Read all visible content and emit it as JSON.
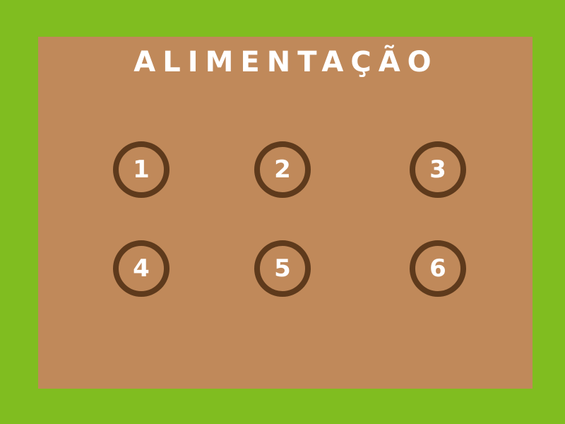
{
  "screen": {
    "title": "ALIMENTAÇÃO"
  },
  "levels": [
    {
      "label": "1"
    },
    {
      "label": "2"
    },
    {
      "label": "3"
    },
    {
      "label": "4"
    },
    {
      "label": "5"
    },
    {
      "label": "6"
    }
  ],
  "colors": {
    "background": "#80bd20",
    "board": "#c0895a",
    "ring": "#5e3a1c",
    "text": "#ffffff"
  }
}
